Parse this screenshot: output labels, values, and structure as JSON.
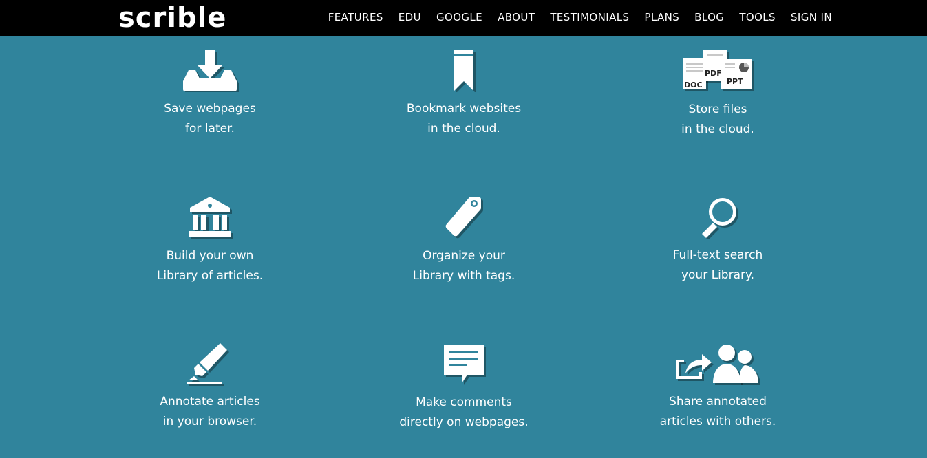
{
  "brand": {
    "logo": "scrible"
  },
  "nav": {
    "items": [
      "FEATURES",
      "EDU",
      "GOOGLE",
      "ABOUT",
      "TESTIMONIALS",
      "PLANS",
      "BLOG",
      "TOOLS",
      "SIGN IN"
    ]
  },
  "features": [
    {
      "icon": "download-tray-icon",
      "line1": "Save webpages",
      "line2": "for later."
    },
    {
      "icon": "bookmark-icon",
      "line1": "Bookmark websites",
      "line2": "in the cloud."
    },
    {
      "icon": "files-doc-pdf-ppt-icon",
      "line1": "Store files",
      "line2": "in the cloud.",
      "file_labels": [
        "DOC",
        "PDF",
        "PPT"
      ]
    },
    {
      "icon": "library-building-icon",
      "line1": "Build your own",
      "line2": "Library of articles."
    },
    {
      "icon": "tag-icon",
      "line1": "Organize your",
      "line2": "Library with tags."
    },
    {
      "icon": "magnifier-icon",
      "line1": "Full-text search",
      "line2": "your Library."
    },
    {
      "icon": "highlighter-icon",
      "line1": "Annotate articles",
      "line2": "in your browser."
    },
    {
      "icon": "comment-bubble-icon",
      "line1": "Make comments",
      "line2": "directly on webpages."
    },
    {
      "icon": "share-users-icon",
      "line1": "Share annotated",
      "line2": "articles with others."
    }
  ],
  "colors": {
    "background": "#30849c",
    "topbar": "#000000",
    "text": "#ffffff"
  }
}
